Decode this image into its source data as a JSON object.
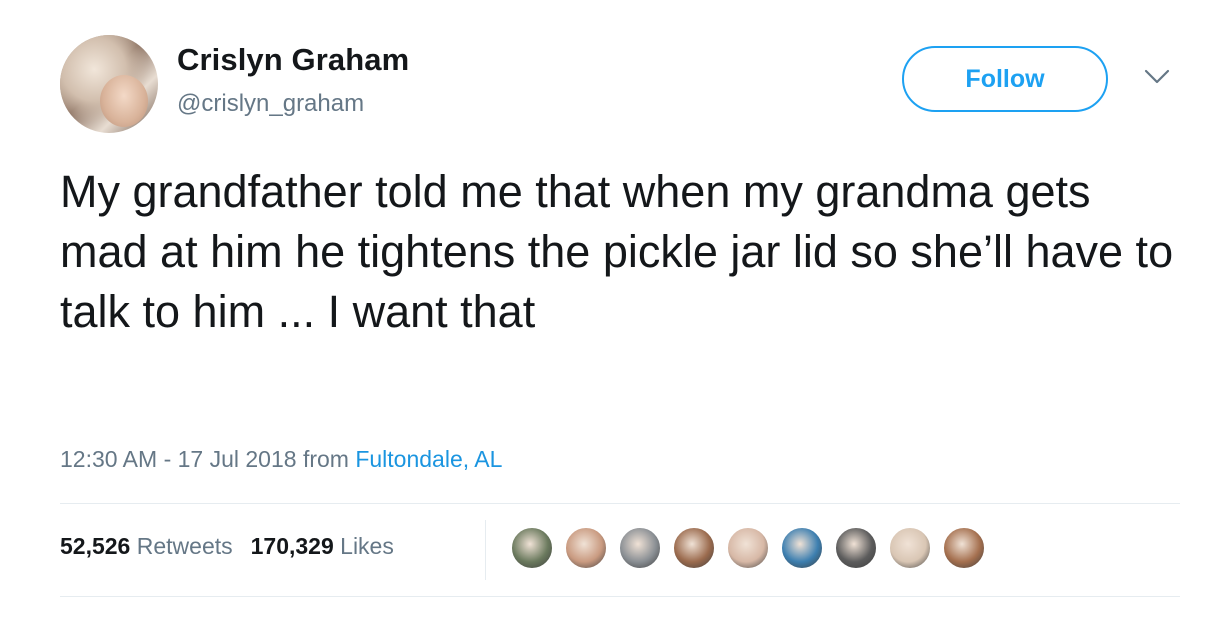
{
  "user": {
    "display_name": "Crislyn Graham",
    "handle": "@crislyn_graham",
    "follow_label": "Follow",
    "avatar_icon": "profile-photo"
  },
  "tweet": {
    "text": "My grandfather told me that when my grandma gets mad at him he tightens the pickle jar lid so she’ll have to talk to him ... I want that",
    "timestamp": "12:30 AM - 17 Jul 2018",
    "from_label": "from",
    "location": "Fultondale, AL"
  },
  "stats": {
    "retweets_count": "52,526",
    "retweets_label": "Retweets",
    "likes_count": "170,329",
    "likes_label": "Likes"
  },
  "likers": [
    {
      "color": "#6b7a5e"
    },
    {
      "color": "#c99a80"
    },
    {
      "color": "#8a8f94"
    },
    {
      "color": "#9b6b4e"
    },
    {
      "color": "#d7b8a6"
    },
    {
      "color": "#3d7fb0"
    },
    {
      "color": "#5c5c5c"
    },
    {
      "color": "#d9c6b4"
    },
    {
      "color": "#a5704f"
    }
  ],
  "colors": {
    "accent": "#1da1f2",
    "text_primary": "#14171a",
    "text_secondary": "#657786",
    "link": "#1b95e0"
  }
}
